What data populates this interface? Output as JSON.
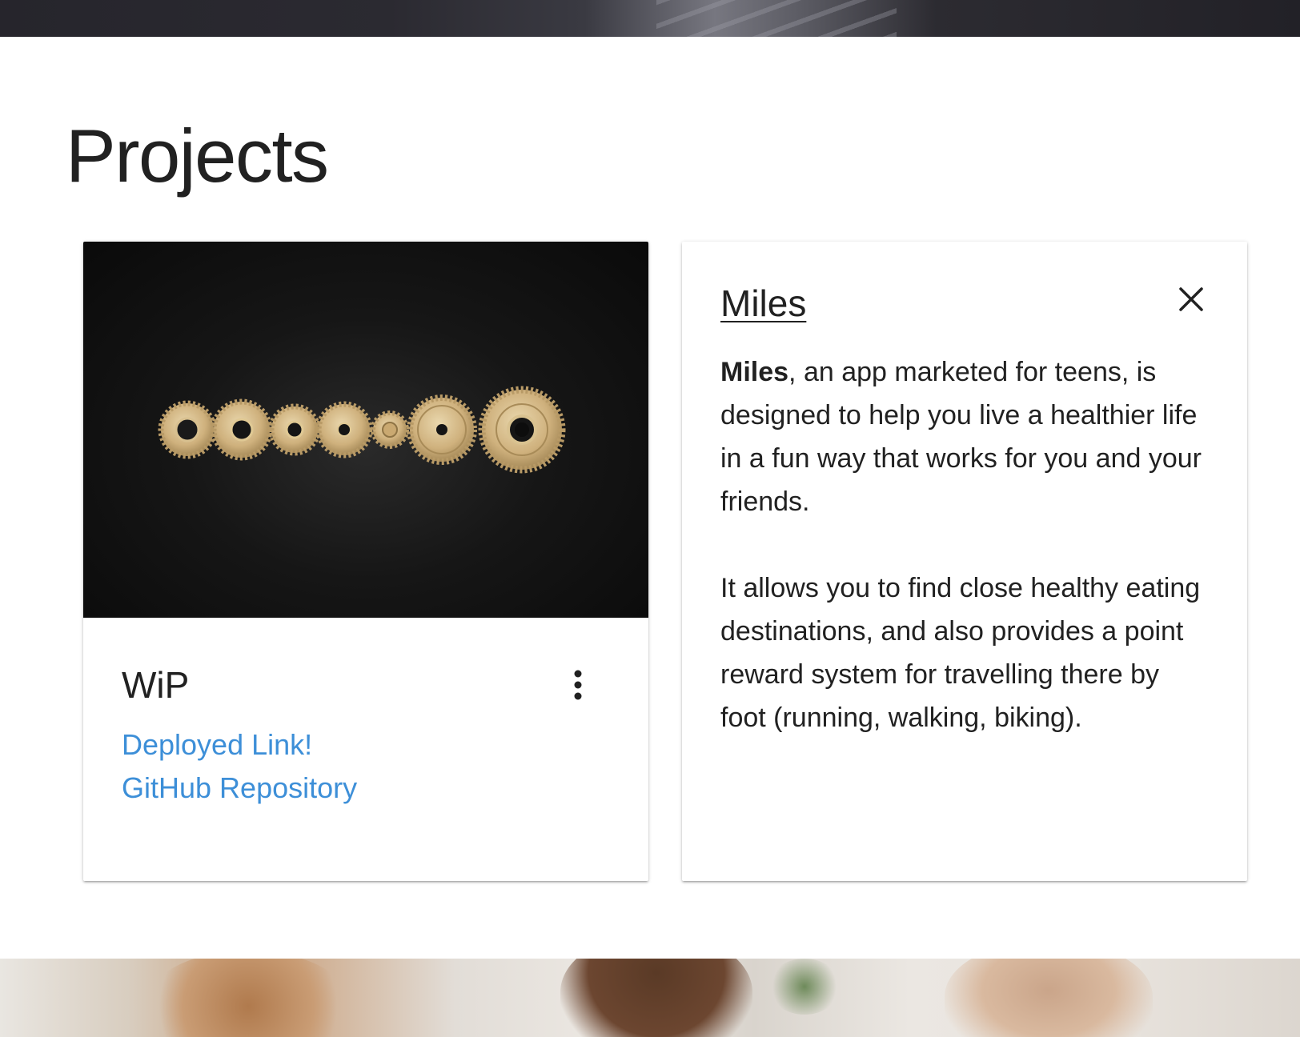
{
  "section": {
    "title": "Projects"
  },
  "project_card": {
    "image_icon": "gears-image",
    "title": "WiP",
    "menu_icon": "more-vert-icon",
    "links": {
      "deployed": "Deployed Link!",
      "github": "GitHub Repository"
    },
    "link_color": "#3d8fd8"
  },
  "reveal_card": {
    "title": "Miles",
    "close_icon": "close-icon",
    "paragraph1_bold": "Miles",
    "paragraph1_rest": ", an app marketed for teens, is designed to help you live a healthier life in a fun way that works for you and your friends.",
    "paragraph2": "It allows you to find close healthy eating destinations, and also provides a point reward system for travelling there by foot (running, walking, biking)."
  }
}
